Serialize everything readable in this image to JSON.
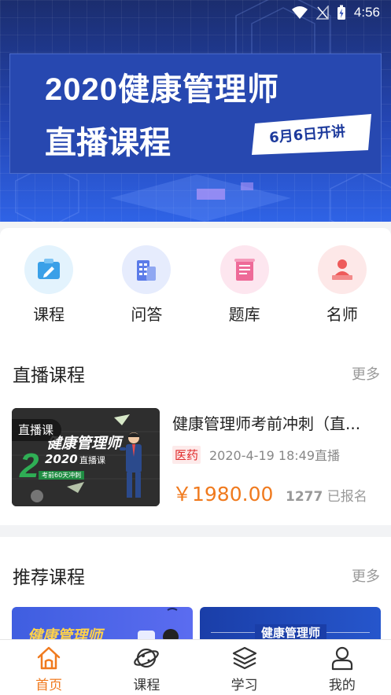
{
  "status": {
    "time": "4:56"
  },
  "banner": {
    "title_line1": "2020健康管理师",
    "title_line2": "直播课程",
    "tag": "6月6日开讲"
  },
  "categories": [
    {
      "label": "课程",
      "icon": "course-icon",
      "bg": "#e3f3fd",
      "color": "#3aa0e8"
    },
    {
      "label": "问答",
      "icon": "qa-building-icon",
      "bg": "#e6ecfd",
      "color": "#5b7be8"
    },
    {
      "label": "题库",
      "icon": "question-bank-icon",
      "bg": "#fde6ef",
      "color": "#ee6a98"
    },
    {
      "label": "名师",
      "icon": "teacher-icon",
      "bg": "#fde8e8",
      "color": "#ee5a5a"
    }
  ],
  "live": {
    "title": "直播课程",
    "more": "更多",
    "course": {
      "badge": "直播课",
      "thumb_title": "健康管理师",
      "thumb_sub": "直播课",
      "thumb_year": "2020",
      "thumb_note": "考前60天冲刺",
      "title": "健康管理师考前冲刺（直...",
      "tag": "医药",
      "time": "2020-4-19 18:49直播",
      "price": "￥1980.00",
      "enroll_count": "1277",
      "enroll_label": "已报名"
    }
  },
  "recommend": {
    "title": "推荐课程",
    "more": "更多",
    "cards": [
      {
        "text": "健康管理师"
      },
      {
        "text": "健康管理师"
      }
    ]
  },
  "tabs": [
    {
      "label": "首页",
      "icon": "home-icon",
      "active": true
    },
    {
      "label": "课程",
      "icon": "planet-icon",
      "active": false
    },
    {
      "label": "学习",
      "icon": "layers-icon",
      "active": false
    },
    {
      "label": "我的",
      "icon": "user-icon",
      "active": false
    }
  ],
  "colors": {
    "accent": "#f07a1e",
    "price": "#f07a1e",
    "tag_red": "#e02a2a"
  }
}
